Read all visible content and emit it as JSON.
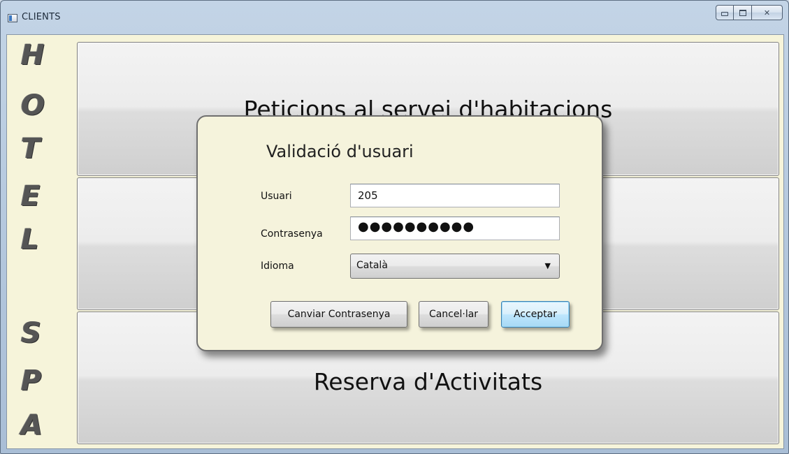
{
  "window": {
    "title": "CLIENTS"
  },
  "sidebar": {
    "letters": [
      "H",
      "O",
      "T",
      "E",
      "L",
      "S",
      "P",
      "A"
    ]
  },
  "main": {
    "buttons": [
      {
        "label": "Peticions al servei d'habitacions"
      },
      {
        "label": ""
      },
      {
        "label": "Reserva d'Activitats"
      }
    ]
  },
  "login_dialog": {
    "title": "Validació d'usuari",
    "user_label": "Usuari",
    "user_value": "205",
    "password_label": "Contrasenya",
    "password_mask": "●●●●●●●●●●",
    "language_label": "Idioma",
    "language_selected": "Català",
    "change_password_button": "Canviar Contrasenya",
    "cancel_button": "Cancel·lar",
    "accept_button": "Acceptar"
  }
}
